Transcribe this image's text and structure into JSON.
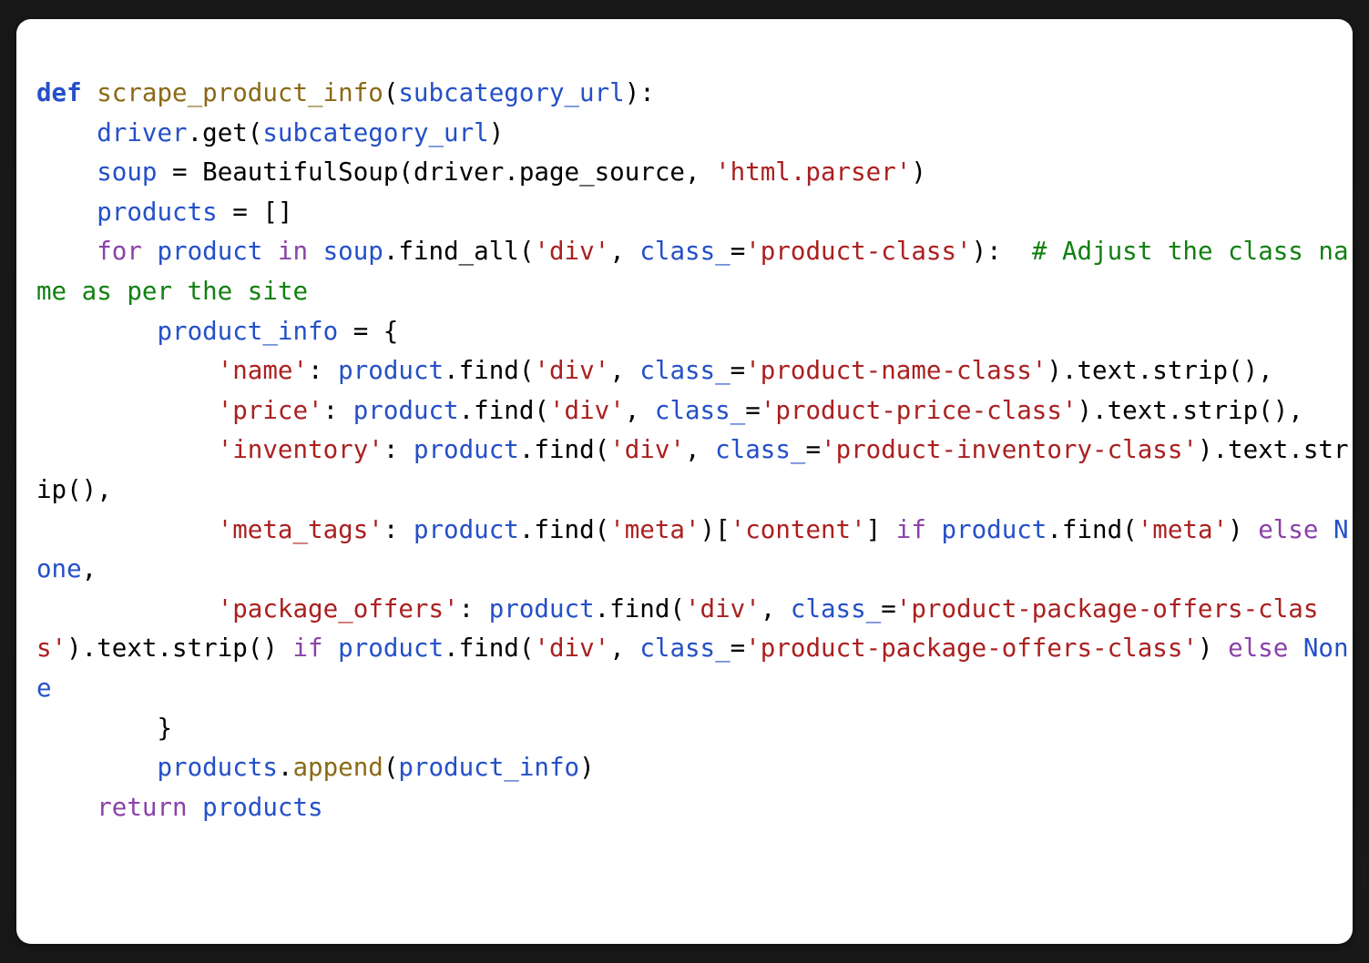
{
  "window": {
    "background_color": "#1c1c1c",
    "card_background": "#ffffff"
  },
  "theme": {
    "keyword_color": "#8b41a8",
    "def_keyword_color": "#2450c8",
    "function_name_color": "#8a6a16",
    "name_color": "#2450c8",
    "string_color": "#ab2020",
    "comment_color": "#128012",
    "operator_color": "#000000"
  },
  "code": {
    "language": "python",
    "full_text": "def scrape_product_info(subcategory_url):\n    driver.get(subcategory_url)\n    soup = BeautifulSoup(driver.page_source, 'html.parser')\n    products = []\n    for product in soup.find_all('div', class_='product-class'):  # Adjust the class name as per the site\n        product_info = {\n            'name': product.find('div', class_='product-name-class').text.strip(),\n            'price': product.find('div', class_='product-price-class').text.strip(),\n            'inventory': product.find('div', class_='product-inventory-class').text.strip(),\n            'meta_tags': product.find('meta')['content'] if product.find('meta') else None,\n            'package_offers': product.find('div', class_='product-package-offers-class').text.strip() if product.find('div', class_='product-package-offers-class') else None\n        }\n        products.append(product_info)\n    return products",
    "lines": [
      {
        "indent": 0,
        "tokens": [
          {
            "t": "def",
            "c": "kwb"
          },
          {
            "t": " ",
            "c": "pl"
          },
          {
            "t": "scrape_product_info",
            "c": "fn"
          },
          {
            "t": "(",
            "c": "op"
          },
          {
            "t": "subcategory_url",
            "c": "nm"
          },
          {
            "t": "):",
            "c": "op"
          }
        ]
      },
      {
        "indent": 4,
        "tokens": [
          {
            "t": "driver",
            "c": "nm"
          },
          {
            "t": ".get(",
            "c": "op"
          },
          {
            "t": "subcategory_url",
            "c": "nm"
          },
          {
            "t": ")",
            "c": "op"
          }
        ]
      },
      {
        "indent": 4,
        "tokens": [
          {
            "t": "soup",
            "c": "nm"
          },
          {
            "t": " = ",
            "c": "op"
          },
          {
            "t": "BeautifulSoup",
            "c": "pl"
          },
          {
            "t": "(",
            "c": "op"
          },
          {
            "t": "driver",
            "c": "pl"
          },
          {
            "t": ".page_source, ",
            "c": "op"
          },
          {
            "t": "'html.parser'",
            "c": "str"
          },
          {
            "t": ")",
            "c": "op"
          }
        ]
      },
      {
        "indent": 4,
        "tokens": [
          {
            "t": "products",
            "c": "nm"
          },
          {
            "t": " = []",
            "c": "op"
          }
        ]
      },
      {
        "indent": 4,
        "tokens": [
          {
            "t": "for ",
            "c": "kw"
          },
          {
            "t": "product",
            "c": "nm"
          },
          {
            "t": " in ",
            "c": "kw"
          },
          {
            "t": "soup",
            "c": "nm"
          },
          {
            "t": ".find_all(",
            "c": "op"
          },
          {
            "t": "'div'",
            "c": "str"
          },
          {
            "t": ", ",
            "c": "op"
          },
          {
            "t": "class_",
            "c": "nm"
          },
          {
            "t": "=",
            "c": "op"
          },
          {
            "t": "'product-class'",
            "c": "str"
          },
          {
            "t": "):  ",
            "c": "op"
          },
          {
            "t": "# Adjust the class name as per the site",
            "c": "cm"
          }
        ]
      },
      {
        "indent": 8,
        "tokens": [
          {
            "t": "product_info",
            "c": "nm"
          },
          {
            "t": " = {",
            "c": "op"
          }
        ]
      },
      {
        "indent": 12,
        "tokens": [
          {
            "t": "'name'",
            "c": "str"
          },
          {
            "t": ": ",
            "c": "op"
          },
          {
            "t": "product",
            "c": "nm"
          },
          {
            "t": ".find(",
            "c": "op"
          },
          {
            "t": "'div'",
            "c": "str"
          },
          {
            "t": ", ",
            "c": "op"
          },
          {
            "t": "class_",
            "c": "nm"
          },
          {
            "t": "=",
            "c": "op"
          },
          {
            "t": "'product-name-class'",
            "c": "str"
          },
          {
            "t": ").text.strip(),",
            "c": "op"
          }
        ]
      },
      {
        "indent": 12,
        "tokens": [
          {
            "t": "'price'",
            "c": "str"
          },
          {
            "t": ": ",
            "c": "op"
          },
          {
            "t": "product",
            "c": "nm"
          },
          {
            "t": ".find(",
            "c": "op"
          },
          {
            "t": "'div'",
            "c": "str"
          },
          {
            "t": ", ",
            "c": "op"
          },
          {
            "t": "class_",
            "c": "nm"
          },
          {
            "t": "=",
            "c": "op"
          },
          {
            "t": "'product-price-class'",
            "c": "str"
          },
          {
            "t": ").text.strip(),",
            "c": "op"
          }
        ]
      },
      {
        "indent": 12,
        "tokens": [
          {
            "t": "'inventory'",
            "c": "str"
          },
          {
            "t": ": ",
            "c": "op"
          },
          {
            "t": "product",
            "c": "nm"
          },
          {
            "t": ".find(",
            "c": "op"
          },
          {
            "t": "'div'",
            "c": "str"
          },
          {
            "t": ", ",
            "c": "op"
          },
          {
            "t": "class_",
            "c": "nm"
          },
          {
            "t": "=",
            "c": "op"
          },
          {
            "t": "'product-inventory-class'",
            "c": "str"
          },
          {
            "t": ").text.strip(),",
            "c": "op"
          }
        ]
      },
      {
        "indent": 12,
        "tokens": [
          {
            "t": "'meta_tags'",
            "c": "str"
          },
          {
            "t": ": ",
            "c": "op"
          },
          {
            "t": "product",
            "c": "nm"
          },
          {
            "t": ".find(",
            "c": "op"
          },
          {
            "t": "'meta'",
            "c": "str"
          },
          {
            "t": ")[",
            "c": "op"
          },
          {
            "t": "'content'",
            "c": "str"
          },
          {
            "t": "] ",
            "c": "op"
          },
          {
            "t": "if ",
            "c": "kw"
          },
          {
            "t": "product",
            "c": "nm"
          },
          {
            "t": ".find(",
            "c": "op"
          },
          {
            "t": "'meta'",
            "c": "str"
          },
          {
            "t": ") ",
            "c": "op"
          },
          {
            "t": "else ",
            "c": "kw"
          },
          {
            "t": "None",
            "c": "nm"
          },
          {
            "t": ",",
            "c": "op"
          }
        ]
      },
      {
        "indent": 12,
        "tokens": [
          {
            "t": "'package_offers'",
            "c": "str"
          },
          {
            "t": ": ",
            "c": "op"
          },
          {
            "t": "product",
            "c": "nm"
          },
          {
            "t": ".find(",
            "c": "op"
          },
          {
            "t": "'div'",
            "c": "str"
          },
          {
            "t": ", ",
            "c": "op"
          },
          {
            "t": "class_",
            "c": "nm"
          },
          {
            "t": "=",
            "c": "op"
          },
          {
            "t": "'product-package-offers-class'",
            "c": "str"
          },
          {
            "t": ").text.strip() ",
            "c": "op"
          },
          {
            "t": "if ",
            "c": "kw"
          },
          {
            "t": "product",
            "c": "nm"
          },
          {
            "t": ".find(",
            "c": "op"
          },
          {
            "t": "'div'",
            "c": "str"
          },
          {
            "t": ", ",
            "c": "op"
          },
          {
            "t": "class_",
            "c": "nm"
          },
          {
            "t": "=",
            "c": "op"
          },
          {
            "t": "'product-package-offers-class'",
            "c": "str"
          },
          {
            "t": ") ",
            "c": "op"
          },
          {
            "t": "else ",
            "c": "kw"
          },
          {
            "t": "None",
            "c": "nm"
          }
        ]
      },
      {
        "indent": 8,
        "tokens": [
          {
            "t": "}",
            "c": "op"
          }
        ]
      },
      {
        "indent": 8,
        "tokens": [
          {
            "t": "products",
            "c": "nm"
          },
          {
            "t": ".",
            "c": "op"
          },
          {
            "t": "append",
            "c": "fn"
          },
          {
            "t": "(",
            "c": "op"
          },
          {
            "t": "product_info",
            "c": "nm"
          },
          {
            "t": ")",
            "c": "op"
          }
        ]
      },
      {
        "indent": 4,
        "tokens": [
          {
            "t": "return ",
            "c": "kw"
          },
          {
            "t": "products",
            "c": "nm"
          }
        ]
      }
    ]
  }
}
